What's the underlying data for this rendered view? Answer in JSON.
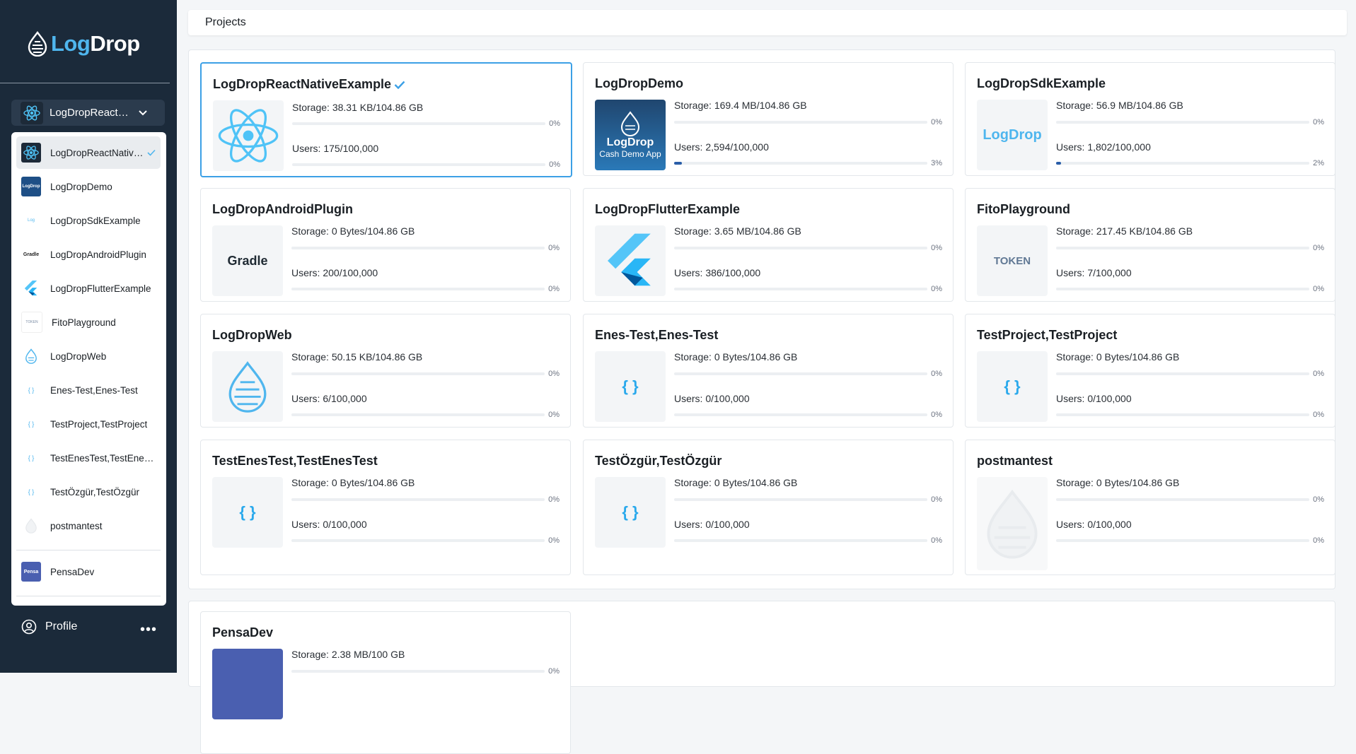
{
  "app": {
    "logo_log": "Log",
    "logo_drop": "Drop"
  },
  "selector": {
    "current": "LogDropReactNativeExample"
  },
  "dropdown": {
    "items": [
      {
        "label": "LogDropReactNativeExample",
        "icon": "react-icon",
        "active": true
      },
      {
        "label": "LogDropDemo",
        "icon": "logdrop-cash-icon"
      },
      {
        "label": "LogDropSdkExample",
        "icon": "logdrop-text-icon"
      },
      {
        "label": "LogDropAndroidPlugin",
        "icon": "gradle-icon"
      },
      {
        "label": "LogDropFlutterExample",
        "icon": "flutter-icon"
      },
      {
        "label": "FitoPlayground",
        "icon": "token-icon"
      },
      {
        "label": "LogDropWeb",
        "icon": "drop-icon"
      },
      {
        "label": "Enes-Test,Enes-Test",
        "icon": "initial-code-icon"
      },
      {
        "label": "TestProject,TestProject",
        "icon": "initial-code-icon"
      },
      {
        "label": "TestEnesTest,TestEnesTest",
        "icon": "initial-code-icon"
      },
      {
        "label": "TestÖzgür,TestÖzgür",
        "icon": "initial-code-icon"
      },
      {
        "label": "postmantest",
        "icon": "faded-drop-icon"
      }
    ],
    "org": {
      "label": "PensaDev",
      "icon": "pensadev-icon"
    }
  },
  "profile": {
    "label": "Profile",
    "more": "•••"
  },
  "breadcrumb": {
    "label": "Projects"
  },
  "cards": [
    {
      "title": "LogDropReactNativeExample",
      "storage": "Storage:",
      "storage_val": "38.31 KB/104.86 GB",
      "storage_pct": "0%",
      "users": "Users:",
      "users_val": "175/100,000",
      "users_pct": "0%",
      "users_fill": 0,
      "icon": "react-icon"
    },
    {
      "title": "LogDropDemo",
      "storage": "Storage:",
      "storage_val": "169.4 MB/104.86 GB",
      "storage_pct": "0%",
      "users": "Users:",
      "users_val": "2,594/100,000",
      "users_pct": "3%",
      "users_fill": 0.03,
      "icon": "logdrop-cash-icon",
      "img_label": "LogDrop",
      "img_sub": "Cash Demo App"
    },
    {
      "title": "LogDropSdkExample",
      "storage": "Storage:",
      "storage_val": "56.9 MB/104.86 GB",
      "storage_pct": "0%",
      "users": "Users:",
      "users_val": "1,802/100,000",
      "users_pct": "2%",
      "users_fill": 0.02,
      "icon": "logdrop-text-icon",
      "img_label": "LogDrop"
    },
    {
      "title": "LogDropAndroidPlugin",
      "storage": "Storage:",
      "storage_val": "0 Bytes/104.86 GB",
      "storage_pct": "0%",
      "users": "Users:",
      "users_val": "200/100,000",
      "users_pct": "0%",
      "users_fill": 0,
      "icon": "gradle-icon",
      "img_label": "Gradle"
    },
    {
      "title": "LogDropFlutterExample",
      "storage": "Storage:",
      "storage_val": "3.65 MB/104.86 GB",
      "storage_pct": "0%",
      "users": "Users:",
      "users_val": "386/100,000",
      "users_pct": "0%",
      "users_fill": 0,
      "icon": "flutter-icon"
    },
    {
      "title": "FitoPlayground",
      "storage": "Storage:",
      "storage_val": "217.45 KB/104.86 GB",
      "storage_pct": "0%",
      "users": "Users:",
      "users_val": "7/100,000",
      "users_pct": "0%",
      "users_fill": 0,
      "icon": "token-icon",
      "img_label": "TOKEN"
    },
    {
      "title": "LogDropWeb",
      "storage": "Storage:",
      "storage_val": "50.15 KB/104.86 GB",
      "storage_pct": "0%",
      "users": "Users:",
      "users_val": "6/100,000",
      "users_pct": "0%",
      "users_fill": 0,
      "icon": "drop-icon"
    },
    {
      "title": "Enes-Test,Enes-Test",
      "storage": "Storage:",
      "storage_val": "0 Bytes/104.86 GB",
      "storage_pct": "0%",
      "users": "Users:",
      "users_val": "0/100,000",
      "users_pct": "0%",
      "users_fill": 0,
      "icon": "initial-code-icon"
    },
    {
      "title": "TestProject,TestProject",
      "storage": "Storage:",
      "storage_val": "0 Bytes/104.86 GB",
      "storage_pct": "0%",
      "users": "Users:",
      "users_val": "0/100,000",
      "users_pct": "0%",
      "users_fill": 0,
      "icon": "initial-code-icon"
    },
    {
      "title": "TestEnesTest,TestEnesTest",
      "storage": "Storage:",
      "storage_val": "0 Bytes/104.86 GB",
      "storage_pct": "0%",
      "users": "Users:",
      "users_val": "0/100,000",
      "users_pct": "0%",
      "users_fill": 0,
      "icon": "initial-code-icon"
    },
    {
      "title": "TestÖzgür,TestÖzgür",
      "storage": "Storage:",
      "storage_val": "0 Bytes/104.86 GB",
      "storage_pct": "0%",
      "users": "Users:",
      "users_val": "0/100,000",
      "users_pct": "0%",
      "users_fill": 0,
      "icon": "initial-code-icon"
    },
    {
      "title": "postmantest",
      "storage": "Storage:",
      "storage_val": "0 Bytes/104.86 GB",
      "storage_pct": "0%",
      "users": "Users:",
      "users_val": "0/100,000",
      "users_pct": "0%",
      "users_fill": 0,
      "icon": "faded-drop-icon"
    }
  ],
  "org_card": {
    "title": "PensaDev",
    "storage": "Storage:",
    "storage_val": "2.38 MB/100 GB",
    "storage_pct": "0%",
    "icon": "pensadev-icon"
  },
  "colors": {
    "sidebar": "#1b2a3a",
    "accent": "#4fb6ee",
    "selected_border": "#3ca0e6",
    "bar_fill": "#2a5ea8"
  }
}
